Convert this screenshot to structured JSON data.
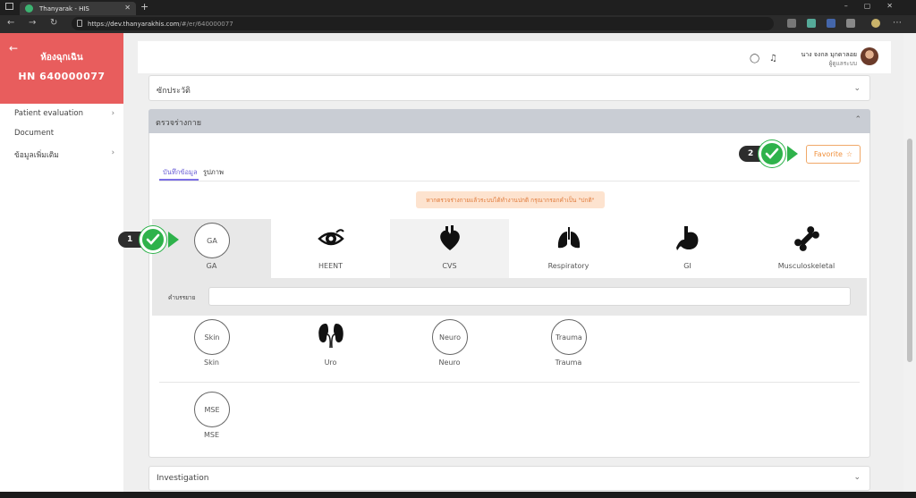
{
  "browser": {
    "tab_title": "Thanyarak - HIS",
    "url_host": "https://dev.thanyarakhis.com",
    "url_path": "/#/er/640000077"
  },
  "sidebar": {
    "title": "ห้องฉุกเฉิน",
    "hn": "HN 640000077",
    "items": [
      {
        "label": "Patient evaluation",
        "has_children": true
      },
      {
        "label": "Document",
        "has_children": false
      },
      {
        "label": "ข้อมูลเพิ่มเติม",
        "has_children": true
      }
    ]
  },
  "header": {
    "user_name": "นาง จงกล มุกดาลอย",
    "user_role": "ผู้ดูแลระบบ"
  },
  "accordions": {
    "history": {
      "title": "ซักประวัติ"
    },
    "physical_exam": {
      "title": "ตรวจร่างกาย"
    },
    "investigation": {
      "title": "Investigation"
    }
  },
  "physical_exam": {
    "favorite_label": "Favorite",
    "subtabs": [
      "บันทึกข้อมูล",
      "รูปภาพ"
    ],
    "notice": "หากตรวจร่างกายแล้วระบบได้ทำงานปกติ กรุณากรอกคำเป็น \"ปกติ\"",
    "description_label": "คำบรรยาย",
    "description_value": "",
    "systems_row1": [
      {
        "abbr": "GA",
        "label": "GA",
        "icon": "circle"
      },
      {
        "abbr": "",
        "label": "HEENT",
        "icon": "eye-icon"
      },
      {
        "abbr": "",
        "label": "CVS",
        "icon": "heart-icon"
      },
      {
        "abbr": "",
        "label": "Respiratory",
        "icon": "lungs-icon"
      },
      {
        "abbr": "",
        "label": "GI",
        "icon": "stomach-icon"
      },
      {
        "abbr": "",
        "label": "Musculoskeletal",
        "icon": "bone-icon"
      }
    ],
    "systems_row2": [
      {
        "abbr": "Skin",
        "label": "Skin",
        "icon": "circle"
      },
      {
        "abbr": "",
        "label": "Uro",
        "icon": "kidney-icon"
      },
      {
        "abbr": "Neuro",
        "label": "Neuro",
        "icon": "circle"
      },
      {
        "abbr": "Trauma",
        "label": "Trauma",
        "icon": "circle"
      }
    ],
    "systems_row3": [
      {
        "abbr": "MSE",
        "label": "MSE",
        "icon": "circle"
      }
    ]
  },
  "annotations": {
    "step1": "1",
    "step2": "2"
  },
  "colors": {
    "sidebar_header": "#e85d5d",
    "accordion_active": "#c9cdd4",
    "favorite_orange": "#f0903c",
    "check_green": "#2eb24b",
    "tab_underline": "#7b6ee6"
  }
}
